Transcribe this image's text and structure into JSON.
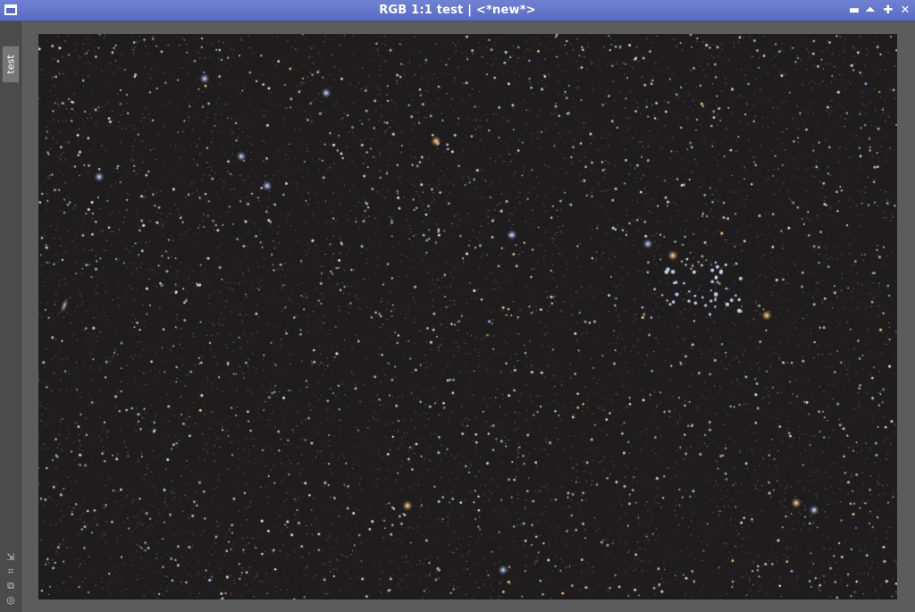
{
  "window": {
    "title": "RGB 1:1 test | <*new*>",
    "icon": "window-icon",
    "controls": [
      {
        "name": "minimize",
        "glyph": "▬"
      },
      {
        "name": "shade",
        "glyph": "⏶"
      },
      {
        "name": "maximize",
        "glyph": "✚"
      },
      {
        "name": "close",
        "glyph": "✕"
      }
    ]
  },
  "sidebar": {
    "tab_label": "test",
    "tools": [
      {
        "name": "fit-view-icon",
        "glyph": "⇲"
      },
      {
        "name": "zoom-to-fit-icon",
        "glyph": "⌗"
      },
      {
        "name": "clone-view-icon",
        "glyph": "⧉"
      },
      {
        "name": "target-icon",
        "glyph": "◎"
      }
    ]
  },
  "colors": {
    "titlebar": "#5a6cc0",
    "sky_background": "#1e1c1c",
    "frame": "#5c5c5c"
  },
  "image": {
    "description_type": "deep-sky star field"
  }
}
